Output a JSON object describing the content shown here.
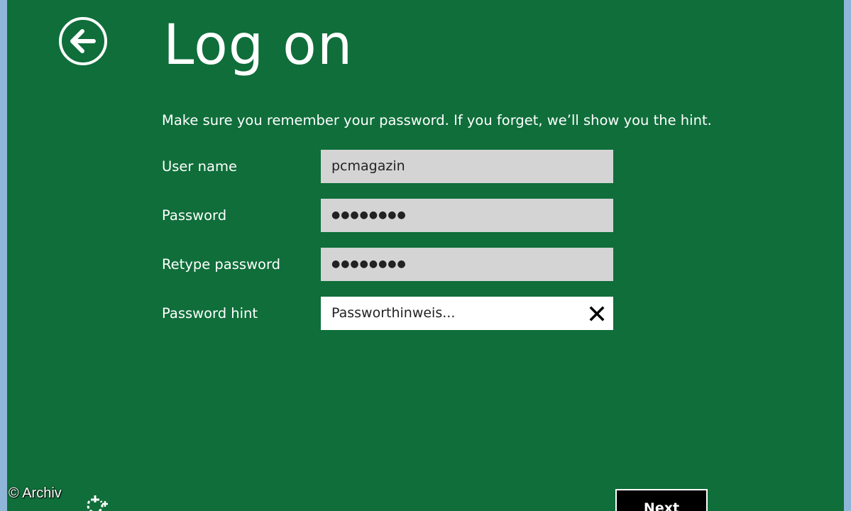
{
  "header": {
    "back_icon": "back-arrow-icon",
    "title": "Log on"
  },
  "instructions": "Make sure you remember your password. If you forget, we’ll show you the hint.",
  "form": {
    "username": {
      "label": "User name",
      "value": "pcmagazin"
    },
    "password": {
      "label": "Password",
      "value": "●●●●●●●●"
    },
    "retype_password": {
      "label": "Retype password",
      "value": "●●●●●●●●"
    },
    "hint": {
      "label": "Password hint",
      "value": "Passworthinweis...",
      "clear_icon": "close-icon"
    }
  },
  "footer": {
    "copyright": "© Archiv",
    "ease_of_access_icon": "ease-of-access-icon",
    "next_label": "Next"
  },
  "colors": {
    "background": "#0f6e3a",
    "field": "#d4d4d4",
    "active_field": "#ffffff",
    "button": "#000000",
    "frame": "#8fb6d8"
  }
}
